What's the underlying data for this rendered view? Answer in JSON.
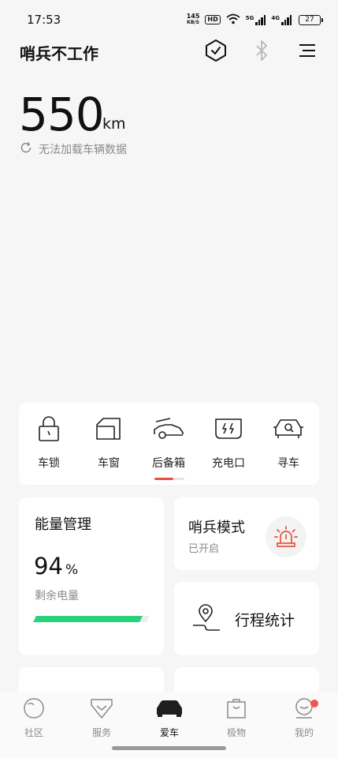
{
  "status_bar": {
    "time": "17:53",
    "net_speed_value": "145",
    "net_speed_unit": "KB/S",
    "hd_label": "HD",
    "signal_1_label": "5G",
    "signal_2_label": "4G",
    "battery_level": "27"
  },
  "header": {
    "title": "哨兵不工作",
    "icons": [
      "shield-check-icon",
      "bluetooth-icon",
      "menu-icon"
    ]
  },
  "range": {
    "value": "550",
    "unit": "km",
    "load_status": "无法加载车辆数据"
  },
  "controls": [
    {
      "label": "车锁",
      "icon": "lock-icon"
    },
    {
      "label": "车窗",
      "icon": "window-icon"
    },
    {
      "label": "后备箱",
      "icon": "trunk-icon"
    },
    {
      "label": "充电口",
      "icon": "charge-port-icon"
    },
    {
      "label": "寻车",
      "icon": "find-car-icon"
    }
  ],
  "energy": {
    "title": "能量管理",
    "value": "94",
    "unit": "%",
    "label": "剩余电量",
    "level_percent": 94,
    "bar_color": "#2ad17d"
  },
  "sentry": {
    "title": "哨兵模式",
    "status": "已开启",
    "icon": "alarm-light-icon",
    "accent": "#e8503a"
  },
  "trip": {
    "label": "行程统计",
    "icon": "route-pin-icon"
  },
  "bottom_nav": {
    "items": [
      {
        "label": "社区",
        "icon": "community-icon",
        "active": false
      },
      {
        "label": "服务",
        "icon": "service-icon",
        "active": false
      },
      {
        "label": "爱车",
        "icon": "car-icon",
        "active": true
      },
      {
        "label": "极物",
        "icon": "shop-bag-icon",
        "active": false
      },
      {
        "label": "我的",
        "icon": "profile-icon",
        "active": false,
        "badge": true
      }
    ]
  }
}
